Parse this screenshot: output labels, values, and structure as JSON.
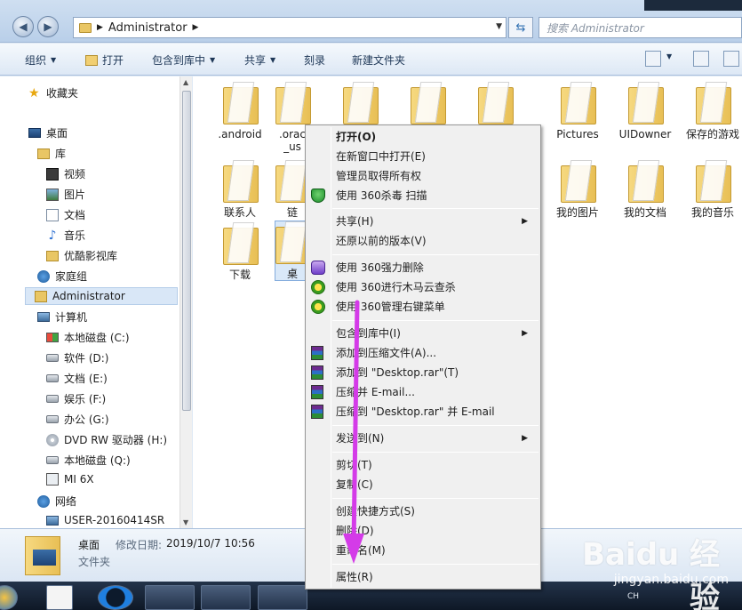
{
  "address": {
    "crumb": "Administrator"
  },
  "search": {
    "placeholder": "搜索 Administrator"
  },
  "toolbar": {
    "organize": "组织",
    "open": "打开",
    "include": "包含到库中",
    "share": "共享",
    "burn": "刻录",
    "new_folder": "新建文件夹"
  },
  "sidebar": {
    "favorites": "收藏夹",
    "desktop": "桌面",
    "libraries": "库",
    "video": "视频",
    "pictures": "图片",
    "documents": "文档",
    "music": "音乐",
    "youku": "优酷影视库",
    "homegroup": "家庭组",
    "admin": "Administrator",
    "computer": "计算机",
    "c": "本地磁盘 (C:)",
    "d": "软件 (D:)",
    "e": "文档 (E:)",
    "f": "娱乐 (F:)",
    "g": "办公 (G:)",
    "h": "DVD RW 驱动器 (H:)",
    "q": "本地磁盘 (Q:)",
    "mi": "MI 6X",
    "network": "网络",
    "netpc": "USER-20160414SR"
  },
  "files": {
    "android": ".android",
    "orac": ".orac",
    "us": "_us",
    "pictures": "Pictures",
    "uidowner": "UIDowner",
    "saved_games": "保存的游戏",
    "contacts": "联系人",
    "lian": "链",
    "my_pictures": "我的图片",
    "my_docs": "我的文档",
    "my_music": "我的音乐",
    "download": "下载",
    "desktop_short": "桌"
  },
  "details": {
    "name": "桌面",
    "modified_label": "修改日期:",
    "modified_value": "2019/10/7 10:56",
    "type": "文件夹"
  },
  "menu": {
    "open": "打开(O)",
    "open_new": "在新窗口中打开(E)",
    "take_owner": "管理员取得所有权",
    "scan360": "使用 360杀毒 扫描",
    "share": "共享(H)",
    "restore": "还原以前的版本(V)",
    "del360": "使用 360强力删除",
    "trojan360": "使用 360进行木马云查杀",
    "manage360": "使用 360管理右键菜单",
    "include": "包含到库中(I)",
    "add_archive": "添加到压缩文件(A)...",
    "add_desktop_rar": "添加到 \"Desktop.rar\"(T)",
    "compress_email": "压缩并 E-mail...",
    "compress_rar_email": "压缩到 \"Desktop.rar\" 并 E-mail",
    "send_to": "发送到(N)",
    "cut": "剪切(T)",
    "copy": "复制(C)",
    "shortcut": "创建快捷方式(S)",
    "delete": "删除(D)",
    "rename": "重命名(M)",
    "properties": "属性(R)"
  },
  "watermark": {
    "main": "Baidu 经验",
    "sub": "jingyan.baidu.com"
  },
  "tray": {
    "lang": "CH"
  },
  "colors": {
    "accent_arrow": "#d43be8",
    "selection": "#cfe3f8"
  }
}
